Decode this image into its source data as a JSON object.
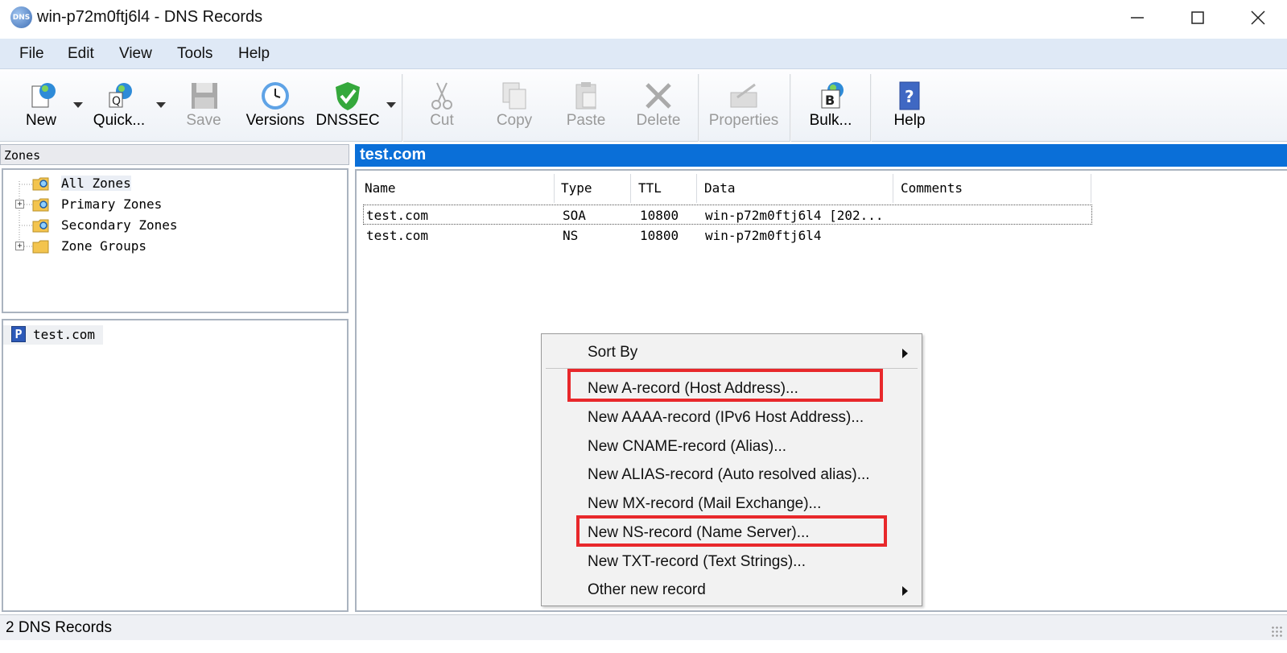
{
  "window": {
    "title": "win-p72m0ftj6l4 - DNS Records",
    "app_icon_text": "DNS",
    "controls": [
      "minimize",
      "maximize",
      "close"
    ]
  },
  "menu": [
    "File",
    "Edit",
    "View",
    "Tools",
    "Help"
  ],
  "toolbar": {
    "new": "New",
    "quick": "Quick...",
    "save": "Save",
    "versions": "Versions",
    "dnssec": "DNSSEC",
    "cut": "Cut",
    "copy": "Copy",
    "paste": "Paste",
    "delete": "Delete",
    "properties": "Properties",
    "bulk": "Bulk...",
    "help": "Help"
  },
  "zones_pane": {
    "header": "Zones",
    "tree": [
      "All Zones",
      "Primary Zones",
      "Secondary Zones",
      "Zone Groups"
    ],
    "list": [
      {
        "badge": "P",
        "name": "test.com"
      }
    ]
  },
  "records_pane": {
    "header": "test.com",
    "columns": [
      "Name",
      "Type",
      "TTL",
      "Data",
      "Comments"
    ],
    "rows": [
      {
        "name": "test.com",
        "type": "SOA",
        "ttl": "10800",
        "data": "win-p72m0ftj6l4 [202...",
        "comments": ""
      },
      {
        "name": "test.com",
        "type": "NS",
        "ttl": "10800",
        "data": "win-p72m0ftj6l4",
        "comments": ""
      }
    ]
  },
  "context_menu": {
    "sort_by": "Sort By",
    "items": [
      "New A-record (Host Address)...",
      "New AAAA-record (IPv6 Host Address)...",
      "New CNAME-record (Alias)...",
      "New ALIAS-record (Auto resolved alias)...",
      "New MX-record (Mail Exchange)...",
      "New NS-record (Name Server)...",
      "New TXT-record (Text Strings)..."
    ],
    "other": "Other new record"
  },
  "status": "2 DNS Records",
  "colors": {
    "selection_header": "#0a6fd8",
    "highlight": "#e8282b",
    "menubar": "#dfe9f6"
  }
}
